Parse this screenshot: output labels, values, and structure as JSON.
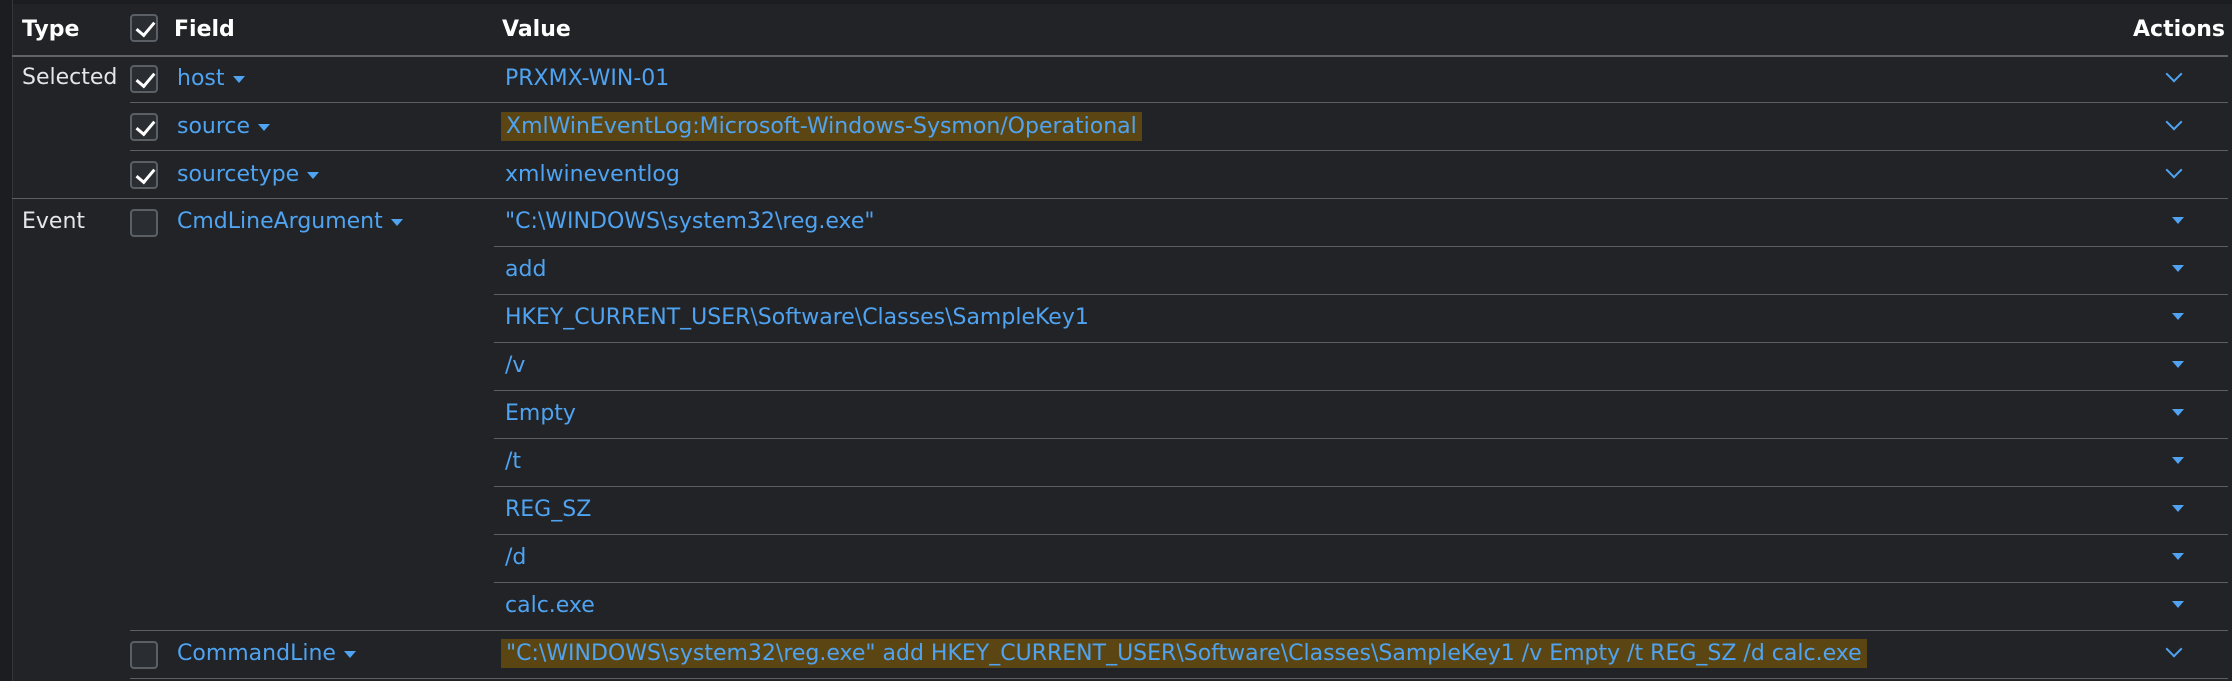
{
  "header": {
    "type": "Type",
    "field": "Field",
    "value": "Value",
    "actions": "Actions"
  },
  "groups": {
    "selected": "Selected",
    "event": "Event"
  },
  "selected_rows": [
    {
      "field": "host",
      "value": "PRXMX-WIN-01",
      "checked": true
    },
    {
      "field": "source",
      "value": "XmlWinEventLog:Microsoft-Windows-Sysmon/Operational",
      "checked": true,
      "highlighted": true
    },
    {
      "field": "sourcetype",
      "value": "xmlwineventlog",
      "checked": true
    }
  ],
  "event_rows": {
    "cmdline_argument": {
      "field": "CmdLineArgument",
      "values": [
        "\"C:\\WINDOWS\\system32\\reg.exe\"",
        "add",
        "HKEY_CURRENT_USER\\Software\\Classes\\SampleKey1",
        "/v",
        "Empty",
        "/t",
        "REG_SZ",
        "/d",
        "calc.exe"
      ]
    },
    "command_line": {
      "field": "CommandLine",
      "value": "\"C:\\WINDOWS\\system32\\reg.exe\" add HKEY_CURRENT_USER\\Software\\Classes\\SampleKey1 /v Empty /t REG_SZ /d calc.exe"
    }
  },
  "colors": {
    "background": "#212327",
    "link": "#4fa3f0",
    "highlight": "#5b4613"
  },
  "icons": [
    "checkbox-icon",
    "caret-down-icon",
    "chevron-down-icon"
  ]
}
